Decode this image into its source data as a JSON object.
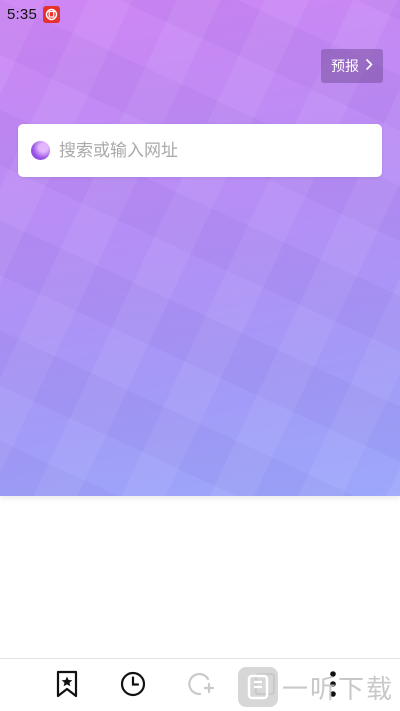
{
  "status_bar": {
    "time": "5:35",
    "notification_icon": "red-app-notification-icon"
  },
  "header": {
    "forecast_label": "预报",
    "forecast_icon": "chevron-right-icon"
  },
  "search": {
    "placeholder": "搜索或输入网址",
    "logo_icon": "purple-browser-logo-icon"
  },
  "bottom_nav": {
    "items": [
      {
        "icon": "bookmark-star-icon"
      },
      {
        "icon": "clock-history-icon"
      },
      {
        "icon": "refresh-add-icon"
      },
      {
        "icon": "tabs-icon"
      },
      {
        "icon": "more-vertical-icon"
      }
    ]
  },
  "watermark": {
    "text": "一听下载"
  },
  "colors": {
    "gradient_top": "#cf86f4",
    "gradient_bottom": "#9ca8fb",
    "accent_purple": "#9b55e8",
    "notification_red": "#e5322d"
  }
}
